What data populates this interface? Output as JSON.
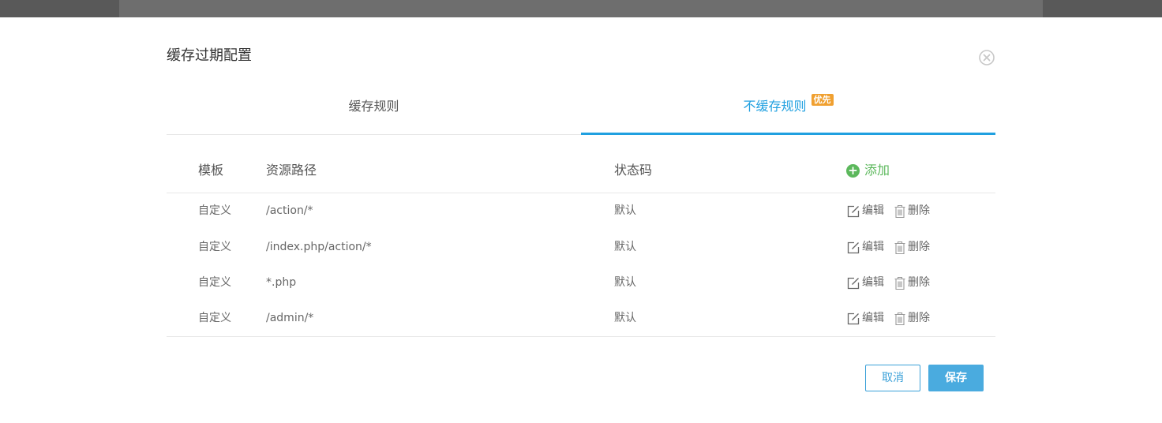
{
  "dialog": {
    "title": "缓存过期配置"
  },
  "tabs": [
    {
      "label": "缓存规则",
      "active": false
    },
    {
      "label": "不缓存规则",
      "active": true,
      "badge": "优先"
    }
  ],
  "table": {
    "headers": {
      "template": "模板",
      "path": "资源路径",
      "status": "状态码",
      "add": "添加"
    },
    "rows": [
      {
        "template": "自定义",
        "path": "/action/*",
        "status": "默认",
        "edit": "编辑",
        "delete": "删除"
      },
      {
        "template": "自定义",
        "path": "/index.php/action/*",
        "status": "默认",
        "edit": "编辑",
        "delete": "删除"
      },
      {
        "template": "自定义",
        "path": "*.php",
        "status": "默认",
        "edit": "编辑",
        "delete": "删除"
      },
      {
        "template": "自定义",
        "path": "/admin/*",
        "status": "默认",
        "edit": "编辑",
        "delete": "删除"
      }
    ]
  },
  "footer": {
    "cancel_label": "取消",
    "save_label": "保存"
  },
  "colors": {
    "accent": "#20a0e0",
    "add_green": "#5cb85c",
    "badge": "#f0a030",
    "save_button": "#4aabdf"
  }
}
